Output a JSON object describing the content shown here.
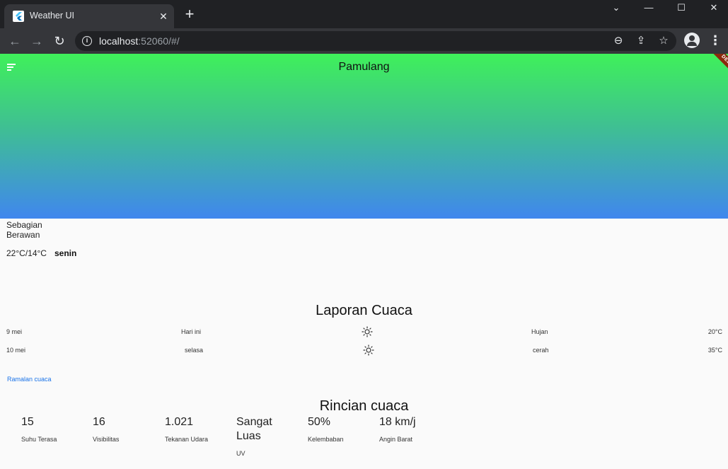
{
  "browser": {
    "tab_title": "Weather UI",
    "tab_close": "✕",
    "new_tab": "+",
    "window_chevron": "⌄",
    "window_minimize": "—",
    "window_maximize": "☐",
    "window_close": "✕",
    "url_host": "localhost",
    "url_rest": ":52060/#/",
    "back": "←",
    "forward": "→",
    "reload": "↻",
    "info": "i",
    "zoom": "⊖",
    "share": "⇪",
    "star": "☆",
    "menu": "⋮"
  },
  "app": {
    "location": "Pamulang",
    "debug_label": "DEBUG",
    "current": {
      "condition_line1": "Sebagian",
      "condition_line2": "Berawan",
      "temp_range": "22°C/14°C",
      "day": "senin"
    },
    "report": {
      "title": "Laporan Cuaca",
      "rows": [
        {
          "date": "9 mei",
          "day": "Hari ini",
          "icon": "sun-icon",
          "condition": "Hujan",
          "temp": "20°C"
        },
        {
          "date": "10 mei",
          "day": "selasa",
          "icon": "sun-icon",
          "condition": "cerah",
          "temp": "35°C"
        }
      ]
    },
    "forecast_link": "Ramalan cuaca",
    "details": {
      "title": "Rincian cuaca",
      "items": [
        {
          "value": "15",
          "label": "Suhu Terasa"
        },
        {
          "value": "16",
          "label": "Visibilitas"
        },
        {
          "value": "1.021",
          "label": "Tekanan Udara"
        },
        {
          "value_line1": "Sangat",
          "value_line2": "Luas",
          "label": "UV"
        },
        {
          "value": "50%",
          "label": "Kelembaban"
        },
        {
          "value": "18 km/j",
          "label": "Angin Barat"
        }
      ]
    }
  }
}
